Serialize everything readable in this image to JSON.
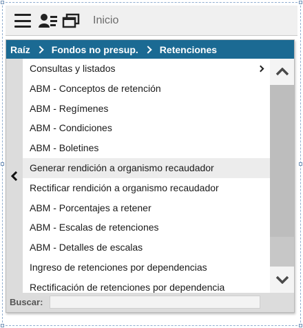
{
  "toolbar": {
    "home_label": "Inicio",
    "icons": [
      "hamburger-menu-icon",
      "user-card-icon",
      "windows-icon"
    ]
  },
  "breadcrumb": {
    "items": [
      "Raíz",
      "Fondos no presup.",
      "Retenciones"
    ]
  },
  "menu": {
    "items": [
      {
        "label": "Consultas y listados",
        "has_submenu": true
      },
      {
        "label": "ABM - Conceptos de retención"
      },
      {
        "label": "ABM - Regímenes"
      },
      {
        "label": "ABM - Condiciones"
      },
      {
        "label": "ABM - Boletines"
      },
      {
        "label": "Generar rendición a organismo recaudador",
        "highlighted": true
      },
      {
        "label": "Rectificar rendición a organismo recaudador"
      },
      {
        "label": "ABM - Porcentajes a retener"
      },
      {
        "label": "ABM - Escalas de retenciones"
      },
      {
        "label": "ABM - Detalles de escalas"
      },
      {
        "label": "Ingreso de retenciones por dependencias"
      },
      {
        "label": "Rectificación de retenciones por dependencia"
      }
    ]
  },
  "search": {
    "label": "Buscar:",
    "value": "",
    "placeholder": ""
  },
  "colors": {
    "breadcrumb_bg": "#1b6a93",
    "highlight_bg": "#ececec"
  }
}
